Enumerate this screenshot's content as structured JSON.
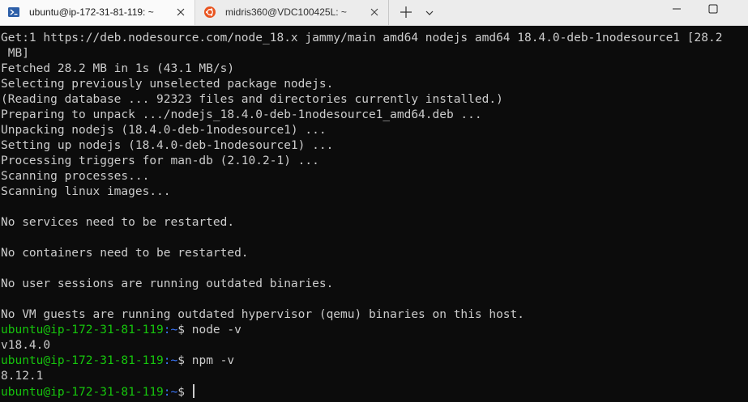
{
  "tabs": [
    {
      "title": "ubuntu@ip-172-31-81-119: ~",
      "icon": "powershell-icon",
      "active": true
    },
    {
      "title": "midris360@VDC100425L: ~",
      "icon": "ubuntu-icon",
      "active": false
    }
  ],
  "colors": {
    "terminal_bg": "#0c0c0c",
    "text": "#cccccc",
    "prompt_user": "#16c60c",
    "prompt_path": "#3b78ff",
    "ubuntu_orange": "#e95420",
    "powershell_blue": "#2d5fa8"
  },
  "terminal": {
    "lines": [
      "Get:1 https://deb.nodesource.com/node_18.x jammy/main amd64 nodejs amd64 18.4.0-deb-1nodesource1 [28.2",
      " MB]",
      "Fetched 28.2 MB in 1s (43.1 MB/s)",
      "Selecting previously unselected package nodejs.",
      "(Reading database ... 92323 files and directories currently installed.)",
      "Preparing to unpack .../nodejs_18.4.0-deb-1nodesource1_amd64.deb ...",
      "Unpacking nodejs (18.4.0-deb-1nodesource1) ...",
      "Setting up nodejs (18.4.0-deb-1nodesource1) ...",
      "Processing triggers for man-db (2.10.2-1) ...",
      "Scanning processes...",
      "Scanning linux images...",
      "",
      "No services need to be restarted.",
      "",
      "No containers need to be restarted.",
      "",
      "No user sessions are running outdated binaries.",
      "",
      "No VM guests are running outdated hypervisor (qemu) binaries on this host."
    ],
    "prompt": {
      "user_host": "ubuntu@ip-172-31-81-119",
      "path": ":~",
      "sign": "$"
    },
    "cmd1": " node -v",
    "out1": "v18.4.0",
    "cmd2": " npm -v",
    "out2": "8.12.1",
    "cmd3": " "
  }
}
